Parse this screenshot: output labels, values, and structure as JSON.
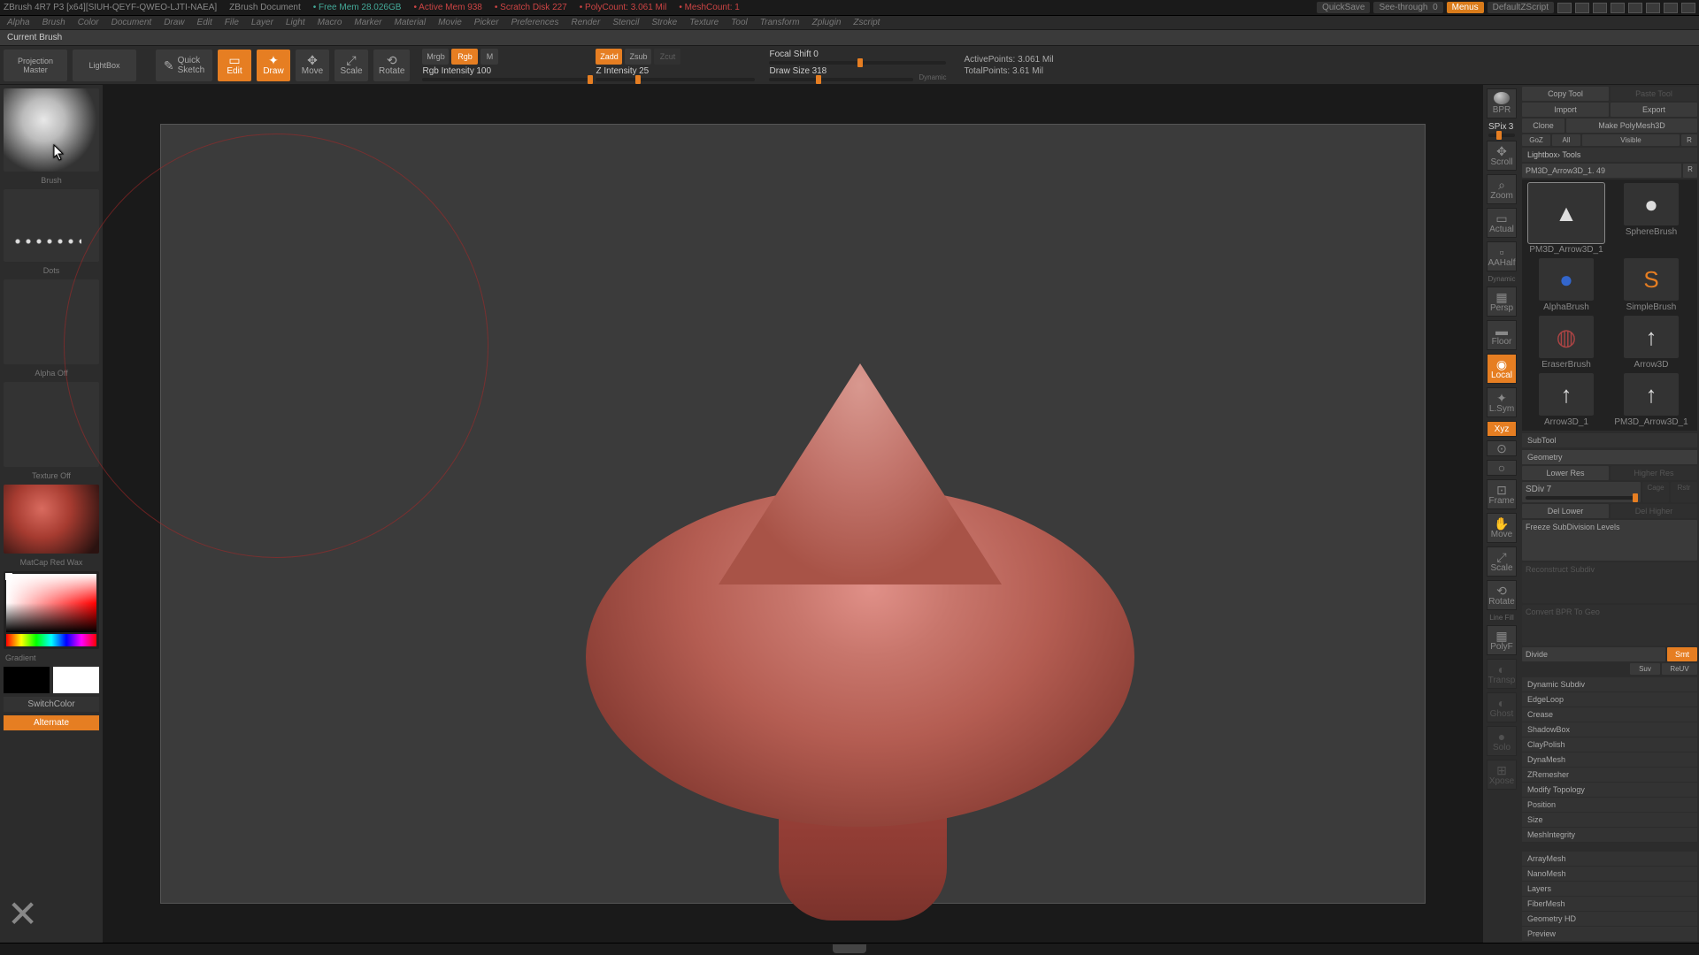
{
  "titlebar": {
    "app": "ZBrush 4R7 P3  [x64][SIUH-QEYF-QWEO-LJTI-NAEA]",
    "doc": "ZBrush Document",
    "free_mem_label": "Free Mem",
    "free_mem": "28.026GB",
    "active_mem_label": "Active Mem",
    "active_mem": "938",
    "scratch_label": "Scratch Disk",
    "scratch": "227",
    "poly_label": "PolyCount:",
    "poly": "3.061  Mil",
    "meshcount_label": "MeshCount:",
    "meshcount": "1",
    "quicksave": "QuickSave",
    "see_through_label": "See-through",
    "see_through_val": "0",
    "menus": "Menus",
    "default_script": "DefaultZScript"
  },
  "menus": [
    "Alpha",
    "Brush",
    "Color",
    "Document",
    "Draw",
    "Edit",
    "File",
    "Layer",
    "Light",
    "Macro",
    "Marker",
    "Material",
    "Movie",
    "Picker",
    "Preferences",
    "Render",
    "Stencil",
    "Stroke",
    "Texture",
    "Tool",
    "Transform",
    "Zplugin",
    "Zscript"
  ],
  "current_brush_label": "Current Brush",
  "toolbar": {
    "projection_master": "Projection\nMaster",
    "lightbox": "LightBox",
    "quick_sketch": "Quick\nSketch",
    "edit": "Edit",
    "draw": "Draw",
    "move": "Move",
    "scale": "Scale",
    "rotate": "Rotate",
    "mrgb": "Mrgb",
    "rgb": "Rgb",
    "m": "M",
    "rgb_intensity_label": "Rgb Intensity",
    "rgb_intensity": "100",
    "zadd": "Zadd",
    "zsub": "Zsub",
    "zcut": "Zcut",
    "z_intensity_label": "Z Intensity",
    "z_intensity": "25",
    "focal_shift_label": "Focal Shift",
    "focal_shift": "0",
    "draw_size_label": "Draw Size",
    "draw_size": "318",
    "dynamic": "Dynamic",
    "active_pts_label": "ActivePoints:",
    "active_pts": "3.061  Mil",
    "total_pts_label": "TotalPoints:",
    "total_pts": "3.61  Mil"
  },
  "left": {
    "brush_label": "Brush",
    "stroke_label": "Dots",
    "alpha_label": "Alpha  Off",
    "texture_label": "Texture  Off",
    "material_label": "MatCap Red Wax",
    "gradient": "Gradient",
    "switch_color": "SwitchColor",
    "alternate": "Alternate"
  },
  "rail": {
    "bpr": "BPR",
    "spix_lbl": "SPix",
    "spix_val": "3",
    "scroll": "Scroll",
    "zoom": "Zoom",
    "actual": "Actual",
    "aahalf": "AAHalf",
    "dynamic": "Dynamic",
    "persp": "Persp",
    "floor": "Floor",
    "local": "Local",
    "lsym": "L.Sym",
    "xyz": "Xyz",
    "frame": "Frame",
    "move": "Move",
    "scale": "Scale",
    "rotate": "Rotate",
    "linefill": "Line Fill",
    "polyf": "PolyF",
    "transp": "Transp",
    "ghost": "Ghost",
    "solo": "Solo",
    "xpose": "Xpose"
  },
  "right": {
    "copy_tool": "Copy Tool",
    "paste_tool": "Paste Tool",
    "import": "Import",
    "export": "Export",
    "clone": "Clone",
    "make_polymesh": "Make PolyMesh3D",
    "goz": "GoZ",
    "all": "All",
    "visible": "Visible",
    "r": "R",
    "lightbox_tools": "Lightbox› Tools",
    "tool_name": "PM3D_Arrow3D_1. 49",
    "tools": [
      {
        "n": "PM3D_Arrow3D_1"
      },
      {
        "n": "SphereBrush"
      },
      {
        "n": "AlphaBrush"
      },
      {
        "n": "SimpleBrush"
      },
      {
        "n": "EraserBrush"
      },
      {
        "n": "Arrow3D"
      },
      {
        "n": "Arrow3D_1"
      },
      {
        "n": "PM3D_Arrow3D_1"
      }
    ],
    "subtool": "SubTool",
    "geometry": "Geometry",
    "lower_res": "Lower Res",
    "higher_res": "Higher Res",
    "sdiv_lbl": "SDiv",
    "sdiv": "7",
    "cage": "Cage",
    "rstr": "Rstr",
    "del_lower": "Del Lower",
    "del_higher": "Del Higher",
    "freeze_subdiv": "Freeze SubDivision Levels",
    "reconstruct": "Reconstruct Subdiv",
    "convert_bpr": "Convert BPR To Geo",
    "divide": "Divide",
    "smt": "Smt",
    "suv": "Suv",
    "reuv": "ReUV",
    "sections": [
      "Dynamic Subdiv",
      "EdgeLoop",
      "Crease",
      "ShadowBox",
      "ClayPolish",
      "DynaMesh",
      "ZRemesher",
      "Modify Topology",
      "Position",
      "Size",
      "MeshIntegrity"
    ],
    "sections2": [
      "ArrayMesh",
      "NanoMesh",
      "Layers",
      "FiberMesh",
      "Geometry HD",
      "Preview"
    ]
  }
}
